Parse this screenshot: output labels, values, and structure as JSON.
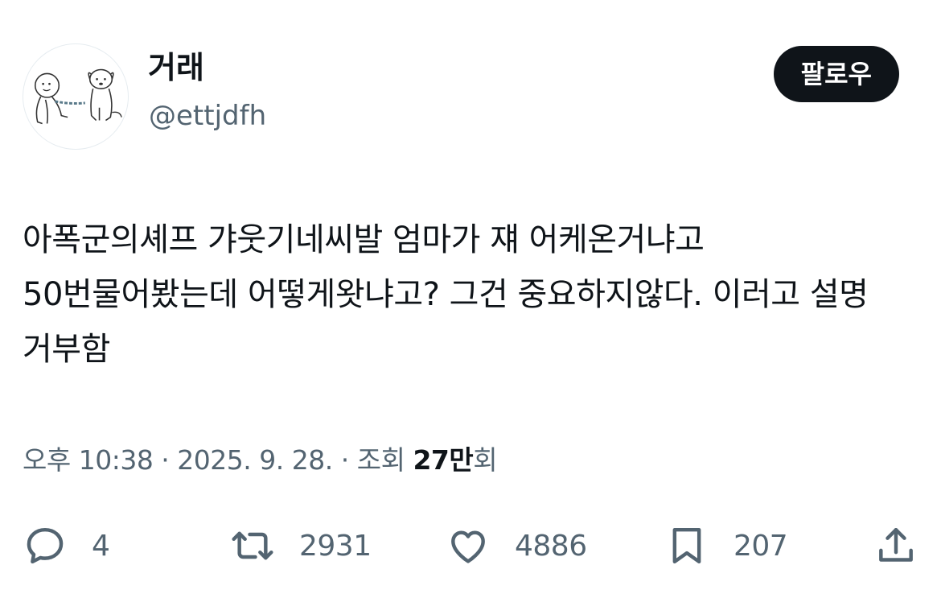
{
  "author": {
    "display_name": "거래",
    "handle": "@ettjdfh",
    "avatar": "cartoon-person-and-dog-avatar"
  },
  "follow_button": {
    "label": "팔로우"
  },
  "tweet": {
    "text": "아폭군의셰프 갸웃기네씨발 엄마가 쟤 어케온거냐고 50번물어봤는데 어떻게왓냐고? 그건 중요하지않다. 이러고 설명 거부함"
  },
  "meta": {
    "time": "오후 10:38",
    "separator": " · ",
    "date": "2025. 9. 28.",
    "views_label": "조회",
    "views_count": "27만",
    "views_suffix": "회"
  },
  "actions": {
    "reply": {
      "icon": "reply-bubble-icon",
      "count": "4"
    },
    "retweet": {
      "icon": "retweet-icon",
      "count": "2931"
    },
    "like": {
      "icon": "heart-icon",
      "count": "4886"
    },
    "bookmark": {
      "icon": "bookmark-icon",
      "count": "207"
    },
    "share": {
      "icon": "share-upload-icon"
    }
  },
  "colors": {
    "text_primary": "#0f1419",
    "text_secondary": "#536471",
    "button_bg": "#0f1419",
    "button_text": "#ffffff"
  }
}
